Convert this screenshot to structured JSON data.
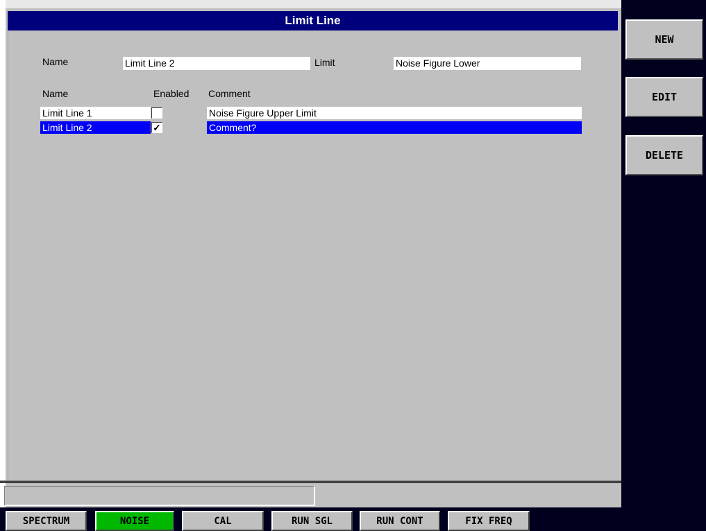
{
  "window": {
    "title": "Limit Line"
  },
  "form": {
    "name_label": "Name",
    "name_value": "Limit Line 2",
    "limit_label": "Limit",
    "limit_value": "Noise Figure Lower"
  },
  "table": {
    "headers": {
      "name": "Name",
      "enabled": "Enabled",
      "comment": "Comment"
    },
    "rows": [
      {
        "name": "Limit Line 1",
        "enabled_mark": "",
        "comment": "Noise Figure Upper Limit",
        "selected": false
      },
      {
        "name": "Limit Line 2",
        "enabled_mark": "✓",
        "comment": "Comment?",
        "selected": true
      }
    ]
  },
  "side_buttons": {
    "new": "NEW",
    "edit": "EDIT",
    "delete": "DELETE"
  },
  "bottom_tabs": {
    "spectrum": "SPECTRUM",
    "noise": "NOISE",
    "cal": "CAL",
    "run_sgl": "RUN SGL",
    "run_cont": "RUN CONT",
    "fix_freq": "FIX FREQ"
  },
  "colors": {
    "title_bar": "#00007c",
    "selection": "#0000f8",
    "active_tab": "#00b800",
    "panel": "#c0c0c0",
    "background": "#00001e"
  }
}
